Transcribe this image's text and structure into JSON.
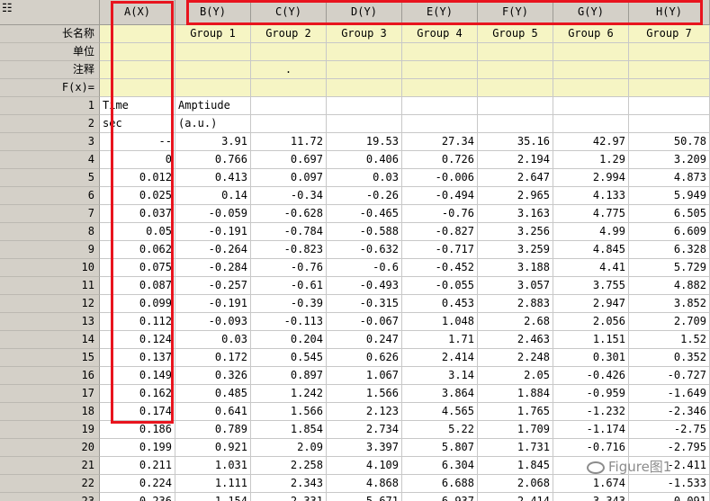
{
  "corner_icon": "worksheet-grid-icon",
  "columns": [
    "A(X)",
    "B(Y)",
    "C(Y)",
    "D(Y)",
    "E(Y)",
    "F(Y)",
    "G(Y)",
    "H(Y)"
  ],
  "meta_rows": [
    {
      "label": "长名称",
      "values": [
        "",
        "Group 1",
        "Group 2",
        "Group 3",
        "Group 4",
        "Group 5",
        "Group 6",
        "Group 7"
      ]
    },
    {
      "label": "单位",
      "values": [
        "",
        "",
        "",
        "",
        "",
        "",
        "",
        ""
      ]
    },
    {
      "label": "注释",
      "values": [
        "",
        "",
        ".",
        "",
        "",
        "",
        "",
        ""
      ]
    },
    {
      "label": "F(x)=",
      "values": [
        "",
        "",
        "",
        "",
        "",
        "",
        "",
        ""
      ]
    }
  ],
  "rows": [
    {
      "n": "1",
      "cells": [
        "Time",
        "Amptiude",
        "",
        "",
        "",
        "",
        "",
        ""
      ]
    },
    {
      "n": "2",
      "cells": [
        "sec",
        "(a.u.)",
        "",
        "",
        "",
        "",
        "",
        ""
      ]
    },
    {
      "n": "3",
      "cells": [
        "--",
        "3.91",
        "11.72",
        "19.53",
        "27.34",
        "35.16",
        "42.97",
        "50.78"
      ]
    },
    {
      "n": "4",
      "cells": [
        "0",
        "0.766",
        "0.697",
        "0.406",
        "0.726",
        "2.194",
        "1.29",
        "3.209"
      ]
    },
    {
      "n": "5",
      "cells": [
        "0.012",
        "0.413",
        "0.097",
        "0.03",
        "-0.006",
        "2.647",
        "2.994",
        "4.873"
      ]
    },
    {
      "n": "6",
      "cells": [
        "0.025",
        "0.14",
        "-0.34",
        "-0.26",
        "-0.494",
        "2.965",
        "4.133",
        "5.949"
      ]
    },
    {
      "n": "7",
      "cells": [
        "0.037",
        "-0.059",
        "-0.628",
        "-0.465",
        "-0.76",
        "3.163",
        "4.775",
        "6.505"
      ]
    },
    {
      "n": "8",
      "cells": [
        "0.05",
        "-0.191",
        "-0.784",
        "-0.588",
        "-0.827",
        "3.256",
        "4.99",
        "6.609"
      ]
    },
    {
      "n": "9",
      "cells": [
        "0.062",
        "-0.264",
        "-0.823",
        "-0.632",
        "-0.717",
        "3.259",
        "4.845",
        "6.328"
      ]
    },
    {
      "n": "10",
      "cells": [
        "0.075",
        "-0.284",
        "-0.76",
        "-0.6",
        "-0.452",
        "3.188",
        "4.41",
        "5.729"
      ]
    },
    {
      "n": "11",
      "cells": [
        "0.087",
        "-0.257",
        "-0.61",
        "-0.493",
        "-0.055",
        "3.057",
        "3.755",
        "4.882"
      ]
    },
    {
      "n": "12",
      "cells": [
        "0.099",
        "-0.191",
        "-0.39",
        "-0.315",
        "0.453",
        "2.883",
        "2.947",
        "3.852"
      ]
    },
    {
      "n": "13",
      "cells": [
        "0.112",
        "-0.093",
        "-0.113",
        "-0.067",
        "1.048",
        "2.68",
        "2.056",
        "2.709"
      ]
    },
    {
      "n": "14",
      "cells": [
        "0.124",
        "0.03",
        "0.204",
        "0.247",
        "1.71",
        "2.463",
        "1.151",
        "1.52"
      ]
    },
    {
      "n": "15",
      "cells": [
        "0.137",
        "0.172",
        "0.545",
        "0.626",
        "2.414",
        "2.248",
        "0.301",
        "0.352"
      ]
    },
    {
      "n": "16",
      "cells": [
        "0.149",
        "0.326",
        "0.897",
        "1.067",
        "3.14",
        "2.05",
        "-0.426",
        "-0.727"
      ]
    },
    {
      "n": "17",
      "cells": [
        "0.162",
        "0.485",
        "1.242",
        "1.566",
        "3.864",
        "1.884",
        "-0.959",
        "-1.649"
      ]
    },
    {
      "n": "18",
      "cells": [
        "0.174",
        "0.641",
        "1.566",
        "2.123",
        "4.565",
        "1.765",
        "-1.232",
        "-2.346"
      ]
    },
    {
      "n": "19",
      "cells": [
        "0.186",
        "0.789",
        "1.854",
        "2.734",
        "5.22",
        "1.709",
        "-1.174",
        "-2.75"
      ]
    },
    {
      "n": "20",
      "cells": [
        "0.199",
        "0.921",
        "2.09",
        "3.397",
        "5.807",
        "1.731",
        "-0.716",
        "-2.795"
      ]
    },
    {
      "n": "21",
      "cells": [
        "0.211",
        "1.031",
        "2.258",
        "4.109",
        "6.304",
        "1.845",
        "",
        "-2.411"
      ]
    },
    {
      "n": "22",
      "cells": [
        "0.224",
        "1.111",
        "2.343",
        "4.868",
        "6.688",
        "2.068",
        "1.674",
        "-1.533"
      ]
    },
    {
      "n": "23",
      "cells": [
        "0.236",
        "1.154",
        "2.331",
        "5.671",
        "6.937",
        "2.414",
        "3.343",
        "0.091"
      ]
    }
  ],
  "watermark": "Figure图1",
  "watermark_icon": "wechat-icon",
  "highlight_color": "#e8141e"
}
